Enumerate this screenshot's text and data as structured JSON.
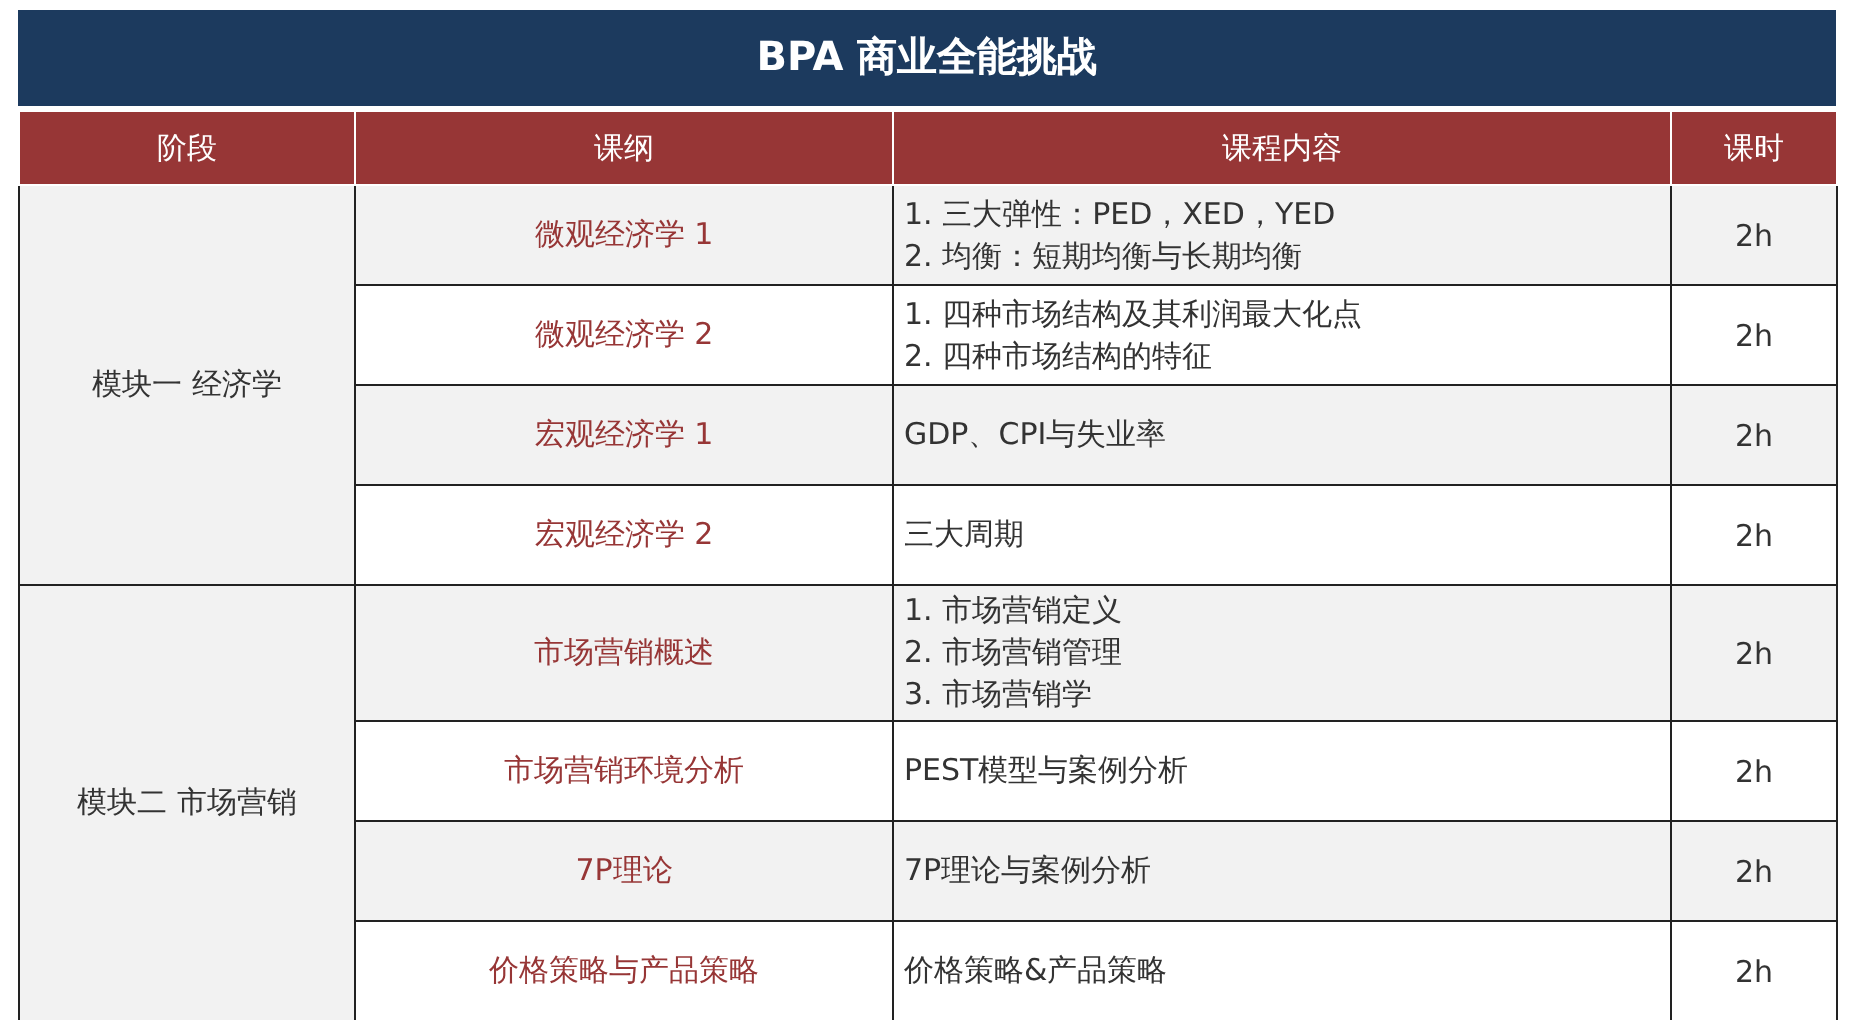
{
  "title": "BPA 商业全能挑战",
  "columns": [
    "阶段",
    "课纲",
    "课程内容",
    "课时"
  ],
  "modules": [
    {
      "stage": "模块一 经济学",
      "courses": [
        {
          "name": "微观经济学 1",
          "content": [
            "1. 三大弹性：PED，XED，YED",
            "2. 均衡：短期均衡与长期均衡"
          ],
          "hours": "2h"
        },
        {
          "name": "微观经济学 2",
          "content": [
            "1. 四种市场结构及其利润最大化点",
            "2. 四种市场结构的特征"
          ],
          "hours": "2h"
        },
        {
          "name": "宏观经济学 1",
          "content": [
            "GDP、CPI与失业率"
          ],
          "hours": "2h"
        },
        {
          "name": "宏观经济学 2",
          "content": [
            "三大周期"
          ],
          "hours": "2h"
        }
      ]
    },
    {
      "stage": "模块二 市场营销",
      "courses": [
        {
          "name": "市场营销概述",
          "content": [
            "1. 市场营销定义",
            "2. 市场营销管理",
            "3. 市场营销学"
          ],
          "hours": "2h"
        },
        {
          "name": "市场营销环境分析",
          "content": [
            "PEST模型与案例分析"
          ],
          "hours": "2h"
        },
        {
          "name": "7P理论",
          "content": [
            "7P理论与案例分析"
          ],
          "hours": "2h"
        },
        {
          "name": "价格策略与产品策略",
          "content": [
            "价格策略&产品策略"
          ],
          "hours": "2h"
        }
      ]
    }
  ]
}
